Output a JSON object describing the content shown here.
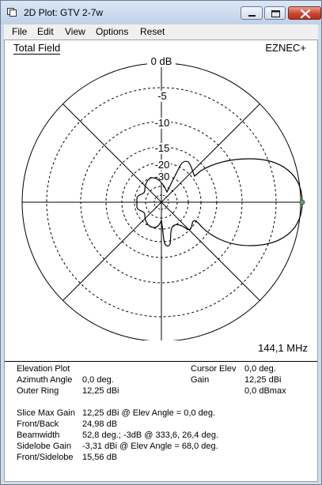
{
  "window": {
    "title": "2D Plot: GTV 2-7w"
  },
  "menu": [
    "File",
    "Edit",
    "View",
    "Options",
    "Reset"
  ],
  "plot": {
    "header_left": "Total Field",
    "header_right": "EZNEC+",
    "frequency": "144,1 MHz",
    "ring_labels": [
      "0 dB",
      "-5",
      "-10",
      "-15",
      "-20",
      "-30"
    ]
  },
  "info": {
    "left": [
      {
        "label": "Elevation Plot",
        "value": ""
      },
      {
        "label": "Azimuth Angle",
        "value": "0,0 deg."
      },
      {
        "label": "Outer Ring",
        "value": "12,25 dBi"
      }
    ],
    "cursor": [
      {
        "label": "Cursor Elev",
        "value": "0,0 deg."
      },
      {
        "label": "Gain",
        "value": "12,25 dBi"
      },
      {
        "label": "",
        "value": "0,0 dBmax"
      }
    ],
    "stats": [
      {
        "label": "Slice Max Gain",
        "value": "12,25 dBi @ Elev Angle = 0,0 deg."
      },
      {
        "label": "Front/Back",
        "value": "24,98 dB"
      },
      {
        "label": "Beamwidth",
        "value": "52,8 deg.; -3dB @ 333,6, 26,4 deg."
      },
      {
        "label": "Sidelobe Gain",
        "value": "-3,31 dBi @ Elev Angle = 68,0 deg."
      },
      {
        "label": "Front/Sidelobe",
        "value": "15,56 dB"
      }
    ]
  },
  "colors": {
    "titlebar": "#cfdcec",
    "close_button": "#c9452e",
    "plot_line": "#000000",
    "cursor_dot": "#6a9a6a"
  }
}
